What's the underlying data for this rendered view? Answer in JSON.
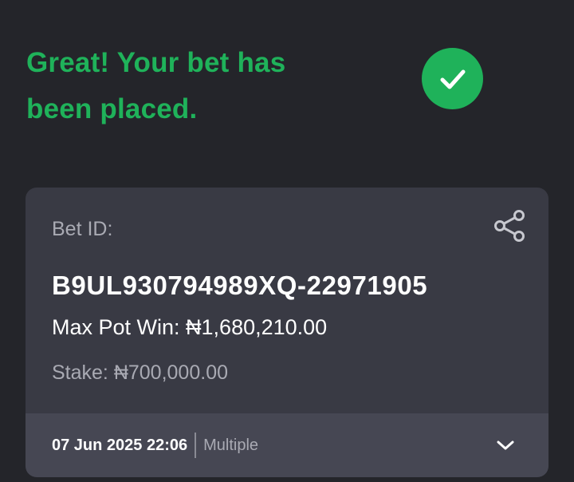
{
  "confirmation": {
    "headline_line1": "Great! Your bet has",
    "headline_line2": "been placed.",
    "icon": "check-circle-icon",
    "accent_color": "#1fb25a"
  },
  "bet_card": {
    "id_label": "Bet ID:",
    "id_value": "B9UL930794989XQ-22971905",
    "max_pot_win": "Max Pot Win: ₦1,680,210.00",
    "stake": "Stake: ₦700,000.00",
    "share_icon": "share-icon",
    "footer": {
      "date": "07 Jun 2025 22:06",
      "bet_type": "Multiple",
      "expand_icon": "chevron-down-icon"
    }
  }
}
